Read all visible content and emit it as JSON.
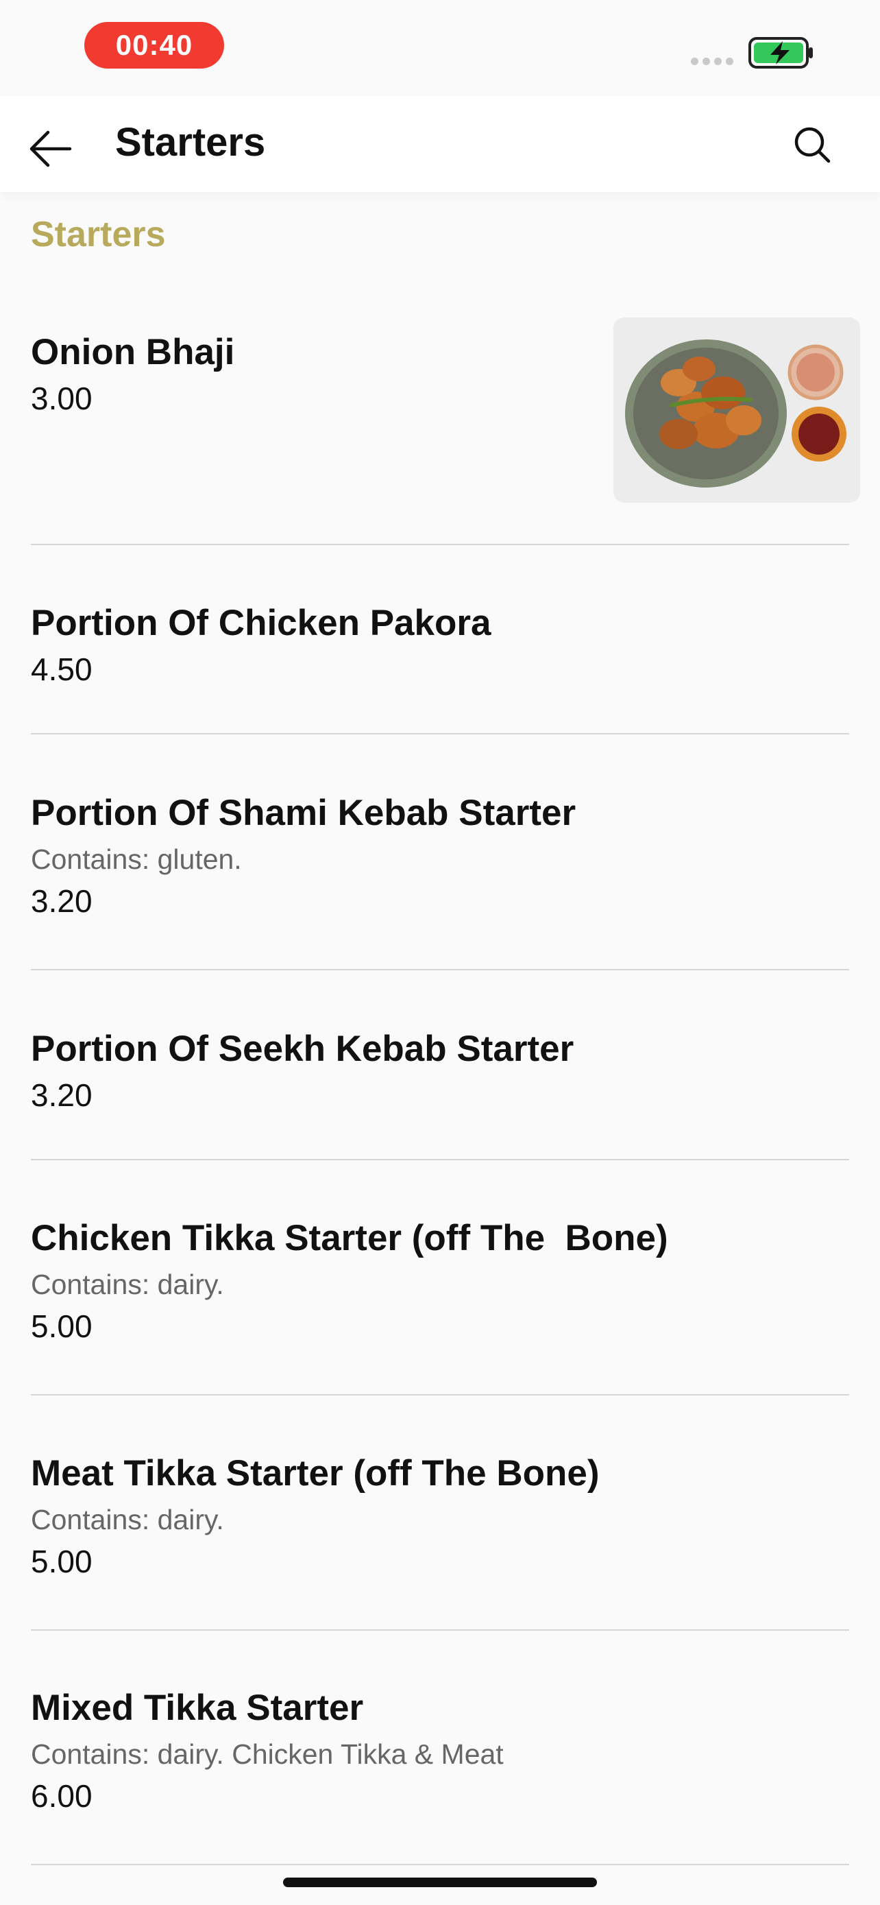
{
  "status": {
    "time": "00:40",
    "battery_color": "#34c759"
  },
  "header": {
    "title": "Starters",
    "back_icon": "arrow-left-icon",
    "search_icon": "search-icon"
  },
  "section": {
    "title": "Starters",
    "accent_color": "#b8aa5c"
  },
  "items": [
    {
      "name": "Onion Bhaji",
      "desc": "",
      "price": "3.00",
      "has_image": true
    },
    {
      "name": "Portion Of Chicken Pakora",
      "desc": "",
      "price": "4.50"
    },
    {
      "name": "Portion Of Shami Kebab Starter",
      "desc": "Contains: gluten.",
      "price": "3.20"
    },
    {
      "name": "Portion Of Seekh Kebab Starter",
      "desc": "",
      "price": "3.20"
    },
    {
      "name": "Chicken Tikka Starter (off The  Bone)",
      "desc": "Contains: dairy.",
      "price": "5.00"
    },
    {
      "name": "Meat Tikka Starter (off The Bone)",
      "desc": "Contains: dairy.",
      "price": "5.00"
    },
    {
      "name": "Mixed Tikka Starter",
      "desc": "Contains: dairy. Chicken Tikka & Meat",
      "price": "6.00"
    }
  ]
}
